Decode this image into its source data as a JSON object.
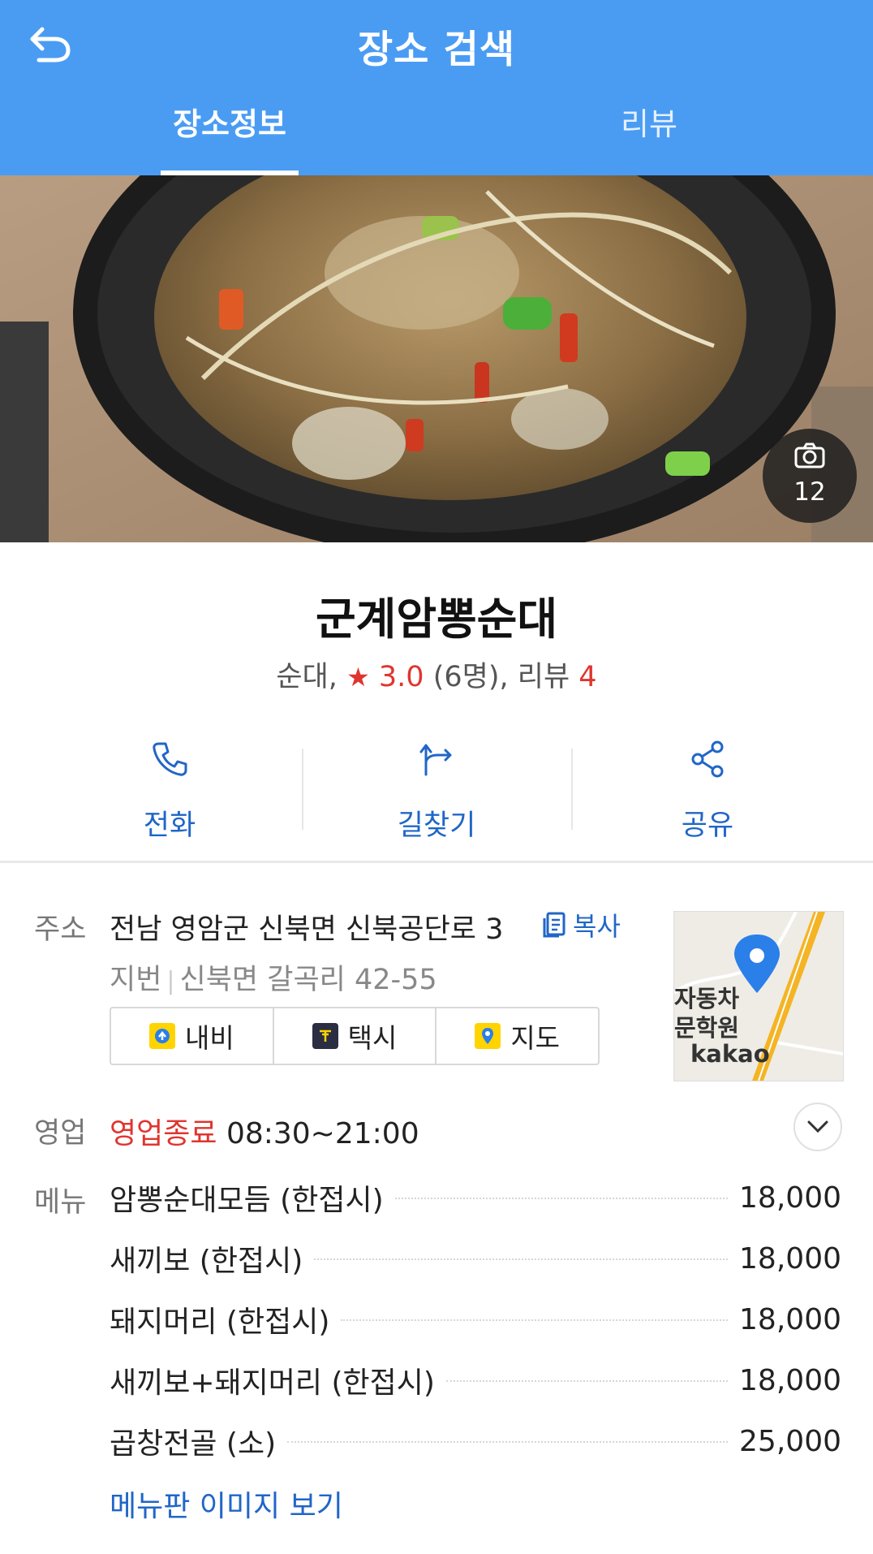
{
  "header": {
    "title": "장소 검색",
    "tabs": [
      {
        "label": "장소정보",
        "active": true
      },
      {
        "label": "리뷰",
        "active": false
      }
    ]
  },
  "photo": {
    "count": "12"
  },
  "place": {
    "name": "군계암뽕순대",
    "category": "순대,",
    "rating": "3.0",
    "raters": "(6명), 리뷰",
    "review_count": "4"
  },
  "actions": {
    "call": "전화",
    "directions": "길찾기",
    "share": "공유"
  },
  "details": {
    "address_label": "주소",
    "address": "전남 영암군 신북면 신북공단로 3",
    "copy_label": "복사",
    "jibun_label": "지번",
    "jibun": "신북면 갈곡리 42-55",
    "buttons": {
      "navi": "내비",
      "taxi": "택시",
      "map": "지도"
    },
    "map_labels": [
      "자동차",
      "문학원",
      "kakao"
    ],
    "hours_label": "영업",
    "status": "영업종료",
    "hours": "08:30~21:00",
    "menu_label": "메뉴",
    "menu": [
      {
        "name": "암뽕순대모듬 (한접시)",
        "price": "18,000"
      },
      {
        "name": "새끼보 (한접시)",
        "price": "18,000"
      },
      {
        "name": "돼지머리 (한접시)",
        "price": "18,000"
      },
      {
        "name": "새끼보+돼지머리 (한접시)",
        "price": "18,000"
      },
      {
        "name": "곱창전골 (소)",
        "price": "25,000"
      }
    ],
    "menu_link": "메뉴판 이미지 보기"
  },
  "colors": {
    "header": "#4a9cf3",
    "link": "#2066c7",
    "accent_red": "#e0352f"
  }
}
